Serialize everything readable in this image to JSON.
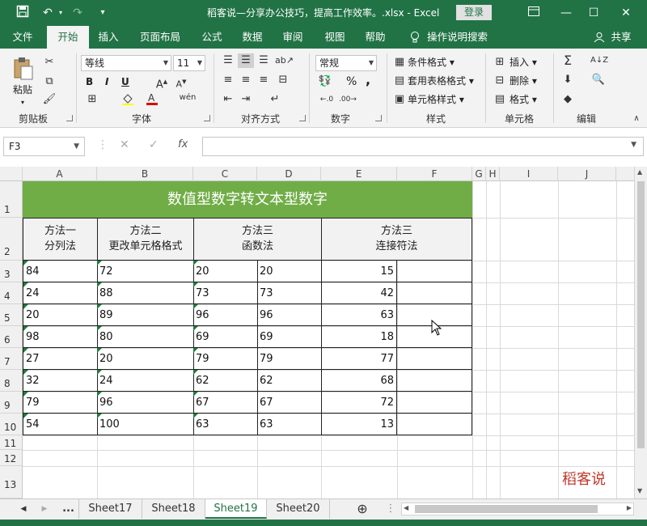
{
  "titlebar": {
    "title": "稻客说—分享办公技巧，提高工作效率。.xlsx - Excel",
    "login": "登录"
  },
  "tabs": [
    "文件",
    "开始",
    "插入",
    "页面布局",
    "公式",
    "数据",
    "审阅",
    "视图",
    "帮助"
  ],
  "tell_me": "操作说明搜索",
  "share": "共享",
  "ribbon": {
    "clipboard": {
      "label": "剪贴板",
      "paste": "粘贴"
    },
    "font": {
      "label": "字体",
      "name": "等线",
      "size": "11",
      "bold": "B",
      "italic": "I",
      "underline": "U"
    },
    "alignment": {
      "label": "对齐方式"
    },
    "number": {
      "label": "数字",
      "format": "常规",
      "percent": "%",
      "comma": ","
    },
    "styles": {
      "label": "样式",
      "cond": "条件格式",
      "table": "套用表格格式",
      "cell": "单元格样式"
    },
    "cells": {
      "label": "单元格",
      "insert": "插入",
      "delete": "删除",
      "format": "格式"
    },
    "editing": {
      "label": "编辑"
    }
  },
  "formula_bar": {
    "namebox": "F3",
    "fx": "fx",
    "value": ""
  },
  "columns": [
    "A",
    "B",
    "C",
    "D",
    "E",
    "F",
    "G",
    "H",
    "I",
    "J"
  ],
  "rows": [
    "1",
    "2",
    "3",
    "4",
    "5",
    "6",
    "7",
    "8",
    "9",
    "10",
    "11",
    "12",
    "13"
  ],
  "sheet": {
    "banner": "数值型数字转文本型数字",
    "headers": [
      {
        "l1": "方法一",
        "l2": "分列法"
      },
      {
        "l1": "方法二",
        "l2": "更改单元格格式"
      },
      {
        "l1": "方法三",
        "l2": "函数法"
      },
      {
        "l1": "方法三",
        "l2": "连接符法"
      }
    ],
    "data": [
      [
        "84",
        "72",
        "20",
        "20",
        "15"
      ],
      [
        "24",
        "88",
        "73",
        "73",
        "42"
      ],
      [
        "20",
        "89",
        "96",
        "96",
        "63"
      ],
      [
        "98",
        "80",
        "69",
        "69",
        "18"
      ],
      [
        "27",
        "20",
        "79",
        "79",
        "77"
      ],
      [
        "32",
        "24",
        "62",
        "62",
        "68"
      ],
      [
        "79",
        "96",
        "67",
        "67",
        "72"
      ],
      [
        "54",
        "100",
        "63",
        "63",
        "13"
      ]
    ],
    "watermark": "稻客说"
  },
  "sheet_tabs": [
    "...",
    "Sheet17",
    "Sheet18",
    "Sheet19",
    "Sheet20"
  ],
  "active_sheet": "Sheet19",
  "accent": "#217346",
  "banner_color": "#70ad47"
}
